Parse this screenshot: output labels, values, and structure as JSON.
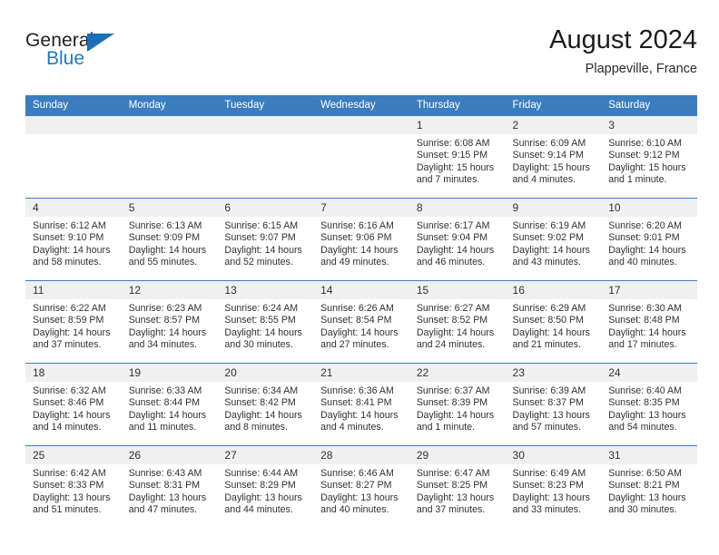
{
  "brand": {
    "word_one": "General",
    "word_two": "Blue",
    "flag_icon": "triangle-flag-icon"
  },
  "header": {
    "title": "August 2024",
    "location": "Plappeville, France"
  },
  "colors": {
    "header_blue": "#3b7dbf",
    "brand_blue": "#1f7ac1",
    "daynum_bg": "#f0f0f0",
    "text": "#303030"
  },
  "calendar": {
    "weekday_headers": [
      "Sunday",
      "Monday",
      "Tuesday",
      "Wednesday",
      "Thursday",
      "Friday",
      "Saturday"
    ],
    "weeks": [
      [
        {
          "empty": true,
          "day": "",
          "lines": []
        },
        {
          "empty": true,
          "day": "",
          "lines": []
        },
        {
          "empty": true,
          "day": "",
          "lines": []
        },
        {
          "empty": true,
          "day": "",
          "lines": []
        },
        {
          "empty": false,
          "day": "1",
          "lines": [
            "Sunrise: 6:08 AM",
            "Sunset: 9:15 PM",
            "Daylight: 15 hours",
            "and 7 minutes."
          ]
        },
        {
          "empty": false,
          "day": "2",
          "lines": [
            "Sunrise: 6:09 AM",
            "Sunset: 9:14 PM",
            "Daylight: 15 hours",
            "and 4 minutes."
          ]
        },
        {
          "empty": false,
          "day": "3",
          "lines": [
            "Sunrise: 6:10 AM",
            "Sunset: 9:12 PM",
            "Daylight: 15 hours",
            "and 1 minute."
          ]
        }
      ],
      [
        {
          "empty": false,
          "day": "4",
          "lines": [
            "Sunrise: 6:12 AM",
            "Sunset: 9:10 PM",
            "Daylight: 14 hours",
            "and 58 minutes."
          ]
        },
        {
          "empty": false,
          "day": "5",
          "lines": [
            "Sunrise: 6:13 AM",
            "Sunset: 9:09 PM",
            "Daylight: 14 hours",
            "and 55 minutes."
          ]
        },
        {
          "empty": false,
          "day": "6",
          "lines": [
            "Sunrise: 6:15 AM",
            "Sunset: 9:07 PM",
            "Daylight: 14 hours",
            "and 52 minutes."
          ]
        },
        {
          "empty": false,
          "day": "7",
          "lines": [
            "Sunrise: 6:16 AM",
            "Sunset: 9:06 PM",
            "Daylight: 14 hours",
            "and 49 minutes."
          ]
        },
        {
          "empty": false,
          "day": "8",
          "lines": [
            "Sunrise: 6:17 AM",
            "Sunset: 9:04 PM",
            "Daylight: 14 hours",
            "and 46 minutes."
          ]
        },
        {
          "empty": false,
          "day": "9",
          "lines": [
            "Sunrise: 6:19 AM",
            "Sunset: 9:02 PM",
            "Daylight: 14 hours",
            "and 43 minutes."
          ]
        },
        {
          "empty": false,
          "day": "10",
          "lines": [
            "Sunrise: 6:20 AM",
            "Sunset: 9:01 PM",
            "Daylight: 14 hours",
            "and 40 minutes."
          ]
        }
      ],
      [
        {
          "empty": false,
          "day": "11",
          "lines": [
            "Sunrise: 6:22 AM",
            "Sunset: 8:59 PM",
            "Daylight: 14 hours",
            "and 37 minutes."
          ]
        },
        {
          "empty": false,
          "day": "12",
          "lines": [
            "Sunrise: 6:23 AM",
            "Sunset: 8:57 PM",
            "Daylight: 14 hours",
            "and 34 minutes."
          ]
        },
        {
          "empty": false,
          "day": "13",
          "lines": [
            "Sunrise: 6:24 AM",
            "Sunset: 8:55 PM",
            "Daylight: 14 hours",
            "and 30 minutes."
          ]
        },
        {
          "empty": false,
          "day": "14",
          "lines": [
            "Sunrise: 6:26 AM",
            "Sunset: 8:54 PM",
            "Daylight: 14 hours",
            "and 27 minutes."
          ]
        },
        {
          "empty": false,
          "day": "15",
          "lines": [
            "Sunrise: 6:27 AM",
            "Sunset: 8:52 PM",
            "Daylight: 14 hours",
            "and 24 minutes."
          ]
        },
        {
          "empty": false,
          "day": "16",
          "lines": [
            "Sunrise: 6:29 AM",
            "Sunset: 8:50 PM",
            "Daylight: 14 hours",
            "and 21 minutes."
          ]
        },
        {
          "empty": false,
          "day": "17",
          "lines": [
            "Sunrise: 6:30 AM",
            "Sunset: 8:48 PM",
            "Daylight: 14 hours",
            "and 17 minutes."
          ]
        }
      ],
      [
        {
          "empty": false,
          "day": "18",
          "lines": [
            "Sunrise: 6:32 AM",
            "Sunset: 8:46 PM",
            "Daylight: 14 hours",
            "and 14 minutes."
          ]
        },
        {
          "empty": false,
          "day": "19",
          "lines": [
            "Sunrise: 6:33 AM",
            "Sunset: 8:44 PM",
            "Daylight: 14 hours",
            "and 11 minutes."
          ]
        },
        {
          "empty": false,
          "day": "20",
          "lines": [
            "Sunrise: 6:34 AM",
            "Sunset: 8:42 PM",
            "Daylight: 14 hours",
            "and 8 minutes."
          ]
        },
        {
          "empty": false,
          "day": "21",
          "lines": [
            "Sunrise: 6:36 AM",
            "Sunset: 8:41 PM",
            "Daylight: 14 hours",
            "and 4 minutes."
          ]
        },
        {
          "empty": false,
          "day": "22",
          "lines": [
            "Sunrise: 6:37 AM",
            "Sunset: 8:39 PM",
            "Daylight: 14 hours",
            "and 1 minute."
          ]
        },
        {
          "empty": false,
          "day": "23",
          "lines": [
            "Sunrise: 6:39 AM",
            "Sunset: 8:37 PM",
            "Daylight: 13 hours",
            "and 57 minutes."
          ]
        },
        {
          "empty": false,
          "day": "24",
          "lines": [
            "Sunrise: 6:40 AM",
            "Sunset: 8:35 PM",
            "Daylight: 13 hours",
            "and 54 minutes."
          ]
        }
      ],
      [
        {
          "empty": false,
          "day": "25",
          "lines": [
            "Sunrise: 6:42 AM",
            "Sunset: 8:33 PM",
            "Daylight: 13 hours",
            "and 51 minutes."
          ]
        },
        {
          "empty": false,
          "day": "26",
          "lines": [
            "Sunrise: 6:43 AM",
            "Sunset: 8:31 PM",
            "Daylight: 13 hours",
            "and 47 minutes."
          ]
        },
        {
          "empty": false,
          "day": "27",
          "lines": [
            "Sunrise: 6:44 AM",
            "Sunset: 8:29 PM",
            "Daylight: 13 hours",
            "and 44 minutes."
          ]
        },
        {
          "empty": false,
          "day": "28",
          "lines": [
            "Sunrise: 6:46 AM",
            "Sunset: 8:27 PM",
            "Daylight: 13 hours",
            "and 40 minutes."
          ]
        },
        {
          "empty": false,
          "day": "29",
          "lines": [
            "Sunrise: 6:47 AM",
            "Sunset: 8:25 PM",
            "Daylight: 13 hours",
            "and 37 minutes."
          ]
        },
        {
          "empty": false,
          "day": "30",
          "lines": [
            "Sunrise: 6:49 AM",
            "Sunset: 8:23 PM",
            "Daylight: 13 hours",
            "and 33 minutes."
          ]
        },
        {
          "empty": false,
          "day": "31",
          "lines": [
            "Sunrise: 6:50 AM",
            "Sunset: 8:21 PM",
            "Daylight: 13 hours",
            "and 30 minutes."
          ]
        }
      ]
    ]
  }
}
